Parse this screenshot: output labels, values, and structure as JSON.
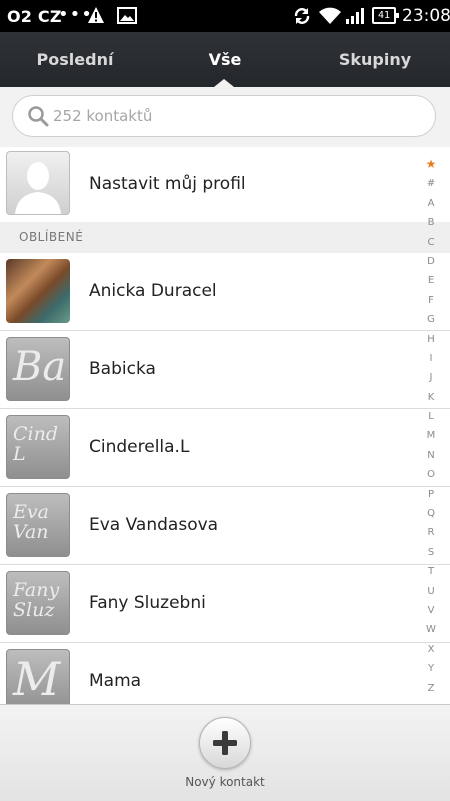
{
  "status_bar": {
    "carrier": "O2 CZ",
    "dots": "•••",
    "battery": "41",
    "time": "23:08"
  },
  "tabs": [
    {
      "label": "Poslední"
    },
    {
      "label": "Vše"
    },
    {
      "label": "Skupiny"
    }
  ],
  "search": {
    "placeholder": "252 kontaktů"
  },
  "profile": {
    "label": "Nastavit můj profil"
  },
  "section": {
    "label": "OBLÍBENÉ"
  },
  "contacts": [
    {
      "name": "Anicka Duracel",
      "avatar": "photo"
    },
    {
      "name": "Babicka",
      "avatar_text": "Ba"
    },
    {
      "name": "Cinderella.L",
      "avatar_text": "Cind L"
    },
    {
      "name": "Eva Vandasova",
      "avatar_text": "Eva Van"
    },
    {
      "name": "Fany Sluzebni",
      "avatar_text": "Fany Sluz"
    },
    {
      "name": "Mama",
      "avatar_text": "M"
    }
  ],
  "alphabet": [
    "★",
    "#",
    "A",
    "B",
    "C",
    "D",
    "E",
    "F",
    "G",
    "H",
    "I",
    "J",
    "K",
    "L",
    "M",
    "N",
    "O",
    "P",
    "Q",
    "R",
    "S",
    "T",
    "U",
    "V",
    "W",
    "X",
    "Y",
    "Z"
  ],
  "bottom": {
    "add_label": "Nový kontakt"
  },
  "colors": {
    "accent": "#e97c20",
    "tabbar": "#2a2d31"
  }
}
